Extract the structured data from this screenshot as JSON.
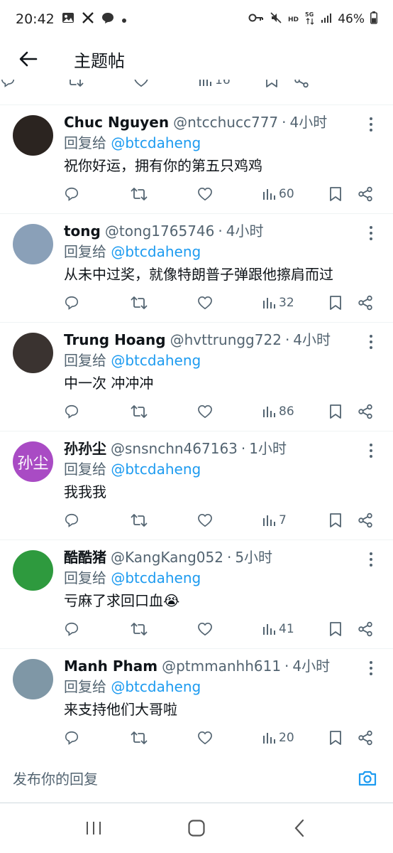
{
  "status": {
    "time": "20:42",
    "battery": "46%"
  },
  "header": {
    "title": "主题帖"
  },
  "partial_top": {
    "views": "16"
  },
  "tweets": [
    {
      "name": "Chuc Nguyen",
      "handle": "@ntcchucc777",
      "time": "4小时",
      "reply_prefix": "回复给",
      "reply_to": "@btcdaheng",
      "text": "祝你好运，拥有你的第五只鸡鸡",
      "views": "60",
      "avatar_text": "",
      "avatar_color": "#2b2420"
    },
    {
      "name": "tong",
      "handle": "@tong1765746",
      "time": "4小时",
      "reply_prefix": "回复给",
      "reply_to": "@btcdaheng",
      "text": "从未中过奖，就像特朗普子弹跟他擦肩而过",
      "views": "32",
      "avatar_text": "",
      "avatar_color": "#8aa0b8"
    },
    {
      "name": "Trung Hoang",
      "handle": "@hvttrungg722",
      "time": "4小时",
      "reply_prefix": "回复给",
      "reply_to": "@btcdaheng",
      "text": "中一次 冲冲冲",
      "views": "86",
      "avatar_text": "",
      "avatar_color": "#3a3330"
    },
    {
      "name": "孙孙尘",
      "handle": "@snsnchn467163",
      "time": "1小时",
      "reply_prefix": "回复给",
      "reply_to": "@btcdaheng",
      "text": "我我我",
      "views": "7",
      "avatar_text": "孙尘",
      "avatar_color": "#a94bc4"
    },
    {
      "name": "酷酷猪",
      "handle": "@KangKang052",
      "time": "5小时",
      "reply_prefix": "回复给",
      "reply_to": "@btcdaheng",
      "text": "亏麻了求回口血😭",
      "views": "41",
      "avatar_text": "",
      "avatar_color": "#2e9a3e"
    },
    {
      "name": "Manh Pham",
      "handle": "@ptmmanhh611",
      "time": "4小时",
      "reply_prefix": "回复给",
      "reply_to": "@btcdaheng",
      "text": "来支持他们大哥啦",
      "views": "20",
      "avatar_text": "",
      "avatar_color": "#7f97a6"
    }
  ],
  "reply_bar": {
    "placeholder": "发布你的回复"
  },
  "colors": {
    "accent": "#1d9bf0",
    "muted": "#536471",
    "text": "#0f1419"
  }
}
